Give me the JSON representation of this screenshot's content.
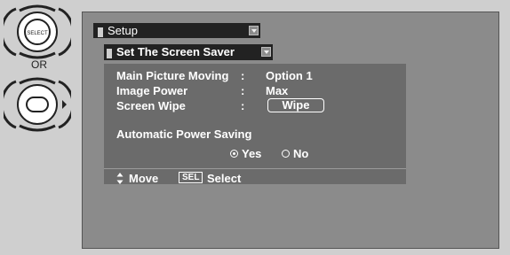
{
  "remote": {
    "select_button_label": "SELECT",
    "or_label": "OR"
  },
  "menu": {
    "title": "Setup",
    "submenu": "Set The Screen Saver",
    "items": [
      {
        "label": "Main Picture Moving",
        "colon": ":",
        "value": "Option 1"
      },
      {
        "label": "Image Power",
        "colon": ":",
        "value": "Max"
      },
      {
        "label": "Screen Wipe",
        "colon": ":",
        "value": "Wipe"
      }
    ],
    "power_saving_label": "Automatic Power Saving",
    "radio_options": [
      {
        "label": "Yes",
        "selected": true
      },
      {
        "label": "No",
        "selected": false
      }
    ],
    "footer": {
      "move_label": "Move",
      "sel_key": "SEL",
      "select_label": "Select"
    }
  },
  "colors": {
    "background": "#cfcfcf",
    "screen": "#8b8b8b",
    "panel": "#6b6b6b",
    "bar": "#222222",
    "text": "#ffffff"
  }
}
